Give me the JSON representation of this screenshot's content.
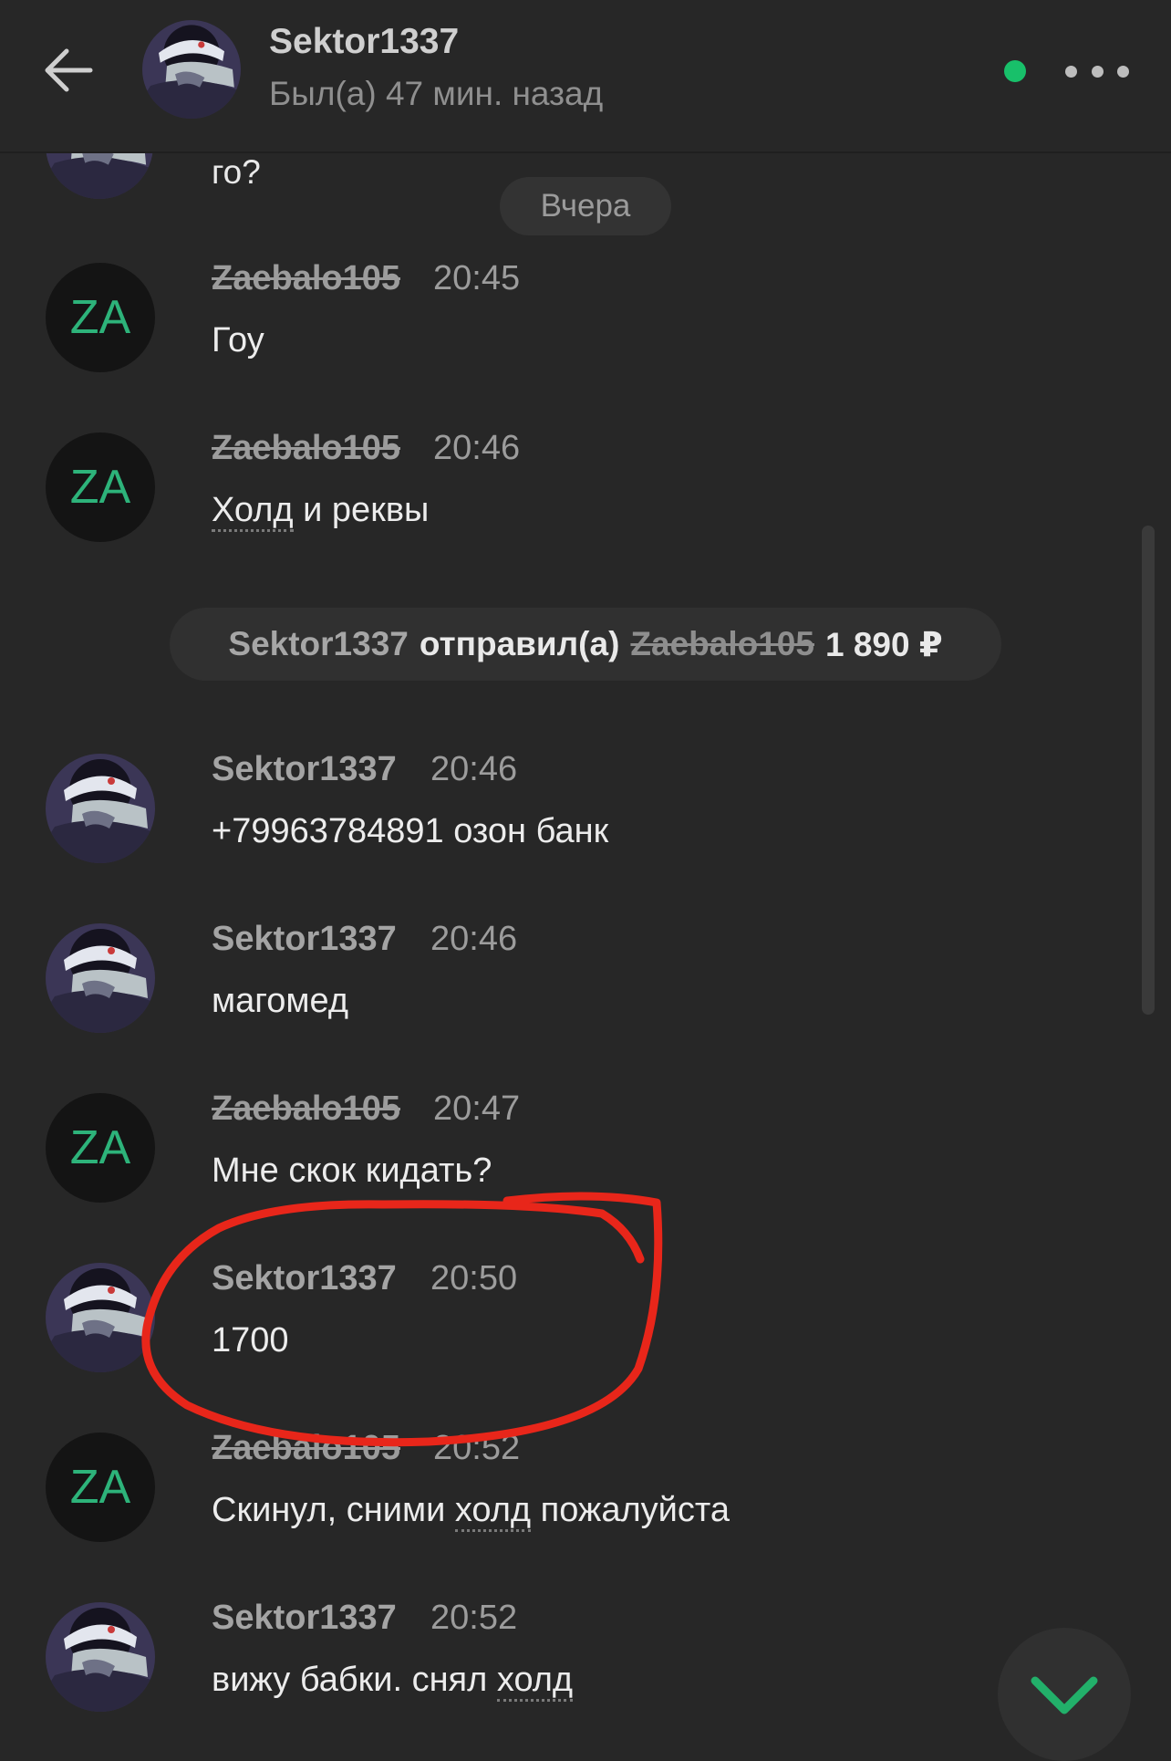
{
  "header": {
    "contact_name": "Sektor1337",
    "status": "Был(а) 47 мин. назад",
    "online_color": "#18c06a"
  },
  "partial_message": {
    "text": "го?"
  },
  "date_separator": "Вчера",
  "system_message": {
    "from": "Sektor1337",
    "verb": "отправил(а)",
    "to": "Zaebalo105",
    "amount": "1 890 ₽"
  },
  "messages": [
    {
      "author": "Zaebalo105",
      "time": "20:45",
      "text": "Гоу"
    },
    {
      "author": "Zaebalo105",
      "time": "20:46",
      "text_before": "",
      "text_underlined": "Холд",
      "text_after": " и реквы"
    },
    {
      "author": "Sektor1337",
      "time": "20:46",
      "text": "+79963784891 озон банк"
    },
    {
      "author": "Sektor1337",
      "time": "20:46",
      "text": "магомед"
    },
    {
      "author": "Zaebalo105",
      "time": "20:47",
      "text": "Мне скок кидать?"
    },
    {
      "author": "Sektor1337",
      "time": "20:50",
      "text": "1700"
    },
    {
      "author": "Zaebalo105",
      "time": "20:52",
      "text_before": "Скинул, сними ",
      "text_underlined": "холд",
      "text_after": " пожалуйста"
    },
    {
      "author": "Sektor1337",
      "time": "20:52",
      "text_before": "вижу бабки. снял ",
      "text_underlined": "холд",
      "text_after": ""
    }
  ],
  "za_avatar_text": "ZA",
  "colors": {
    "background": "#272727",
    "accent_green": "#2db37a",
    "annotation_red": "#e8261a"
  },
  "icons": {
    "back": "arrow-left-icon",
    "more": "ellipsis-icon",
    "scroll_down": "chevron-down-icon"
  }
}
